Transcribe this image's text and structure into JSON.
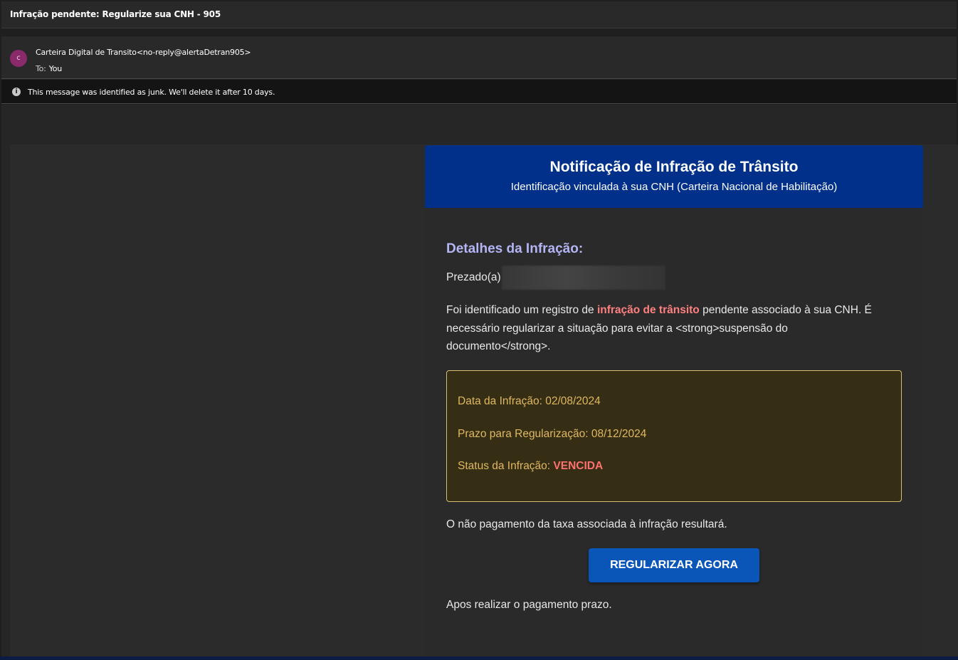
{
  "email": {
    "subject": "Infração pendente: Regularize sua CNH - 905",
    "avatar_initial": "c",
    "sender": "Carteira Digital de Transito<no-reply@alertaDetran905>",
    "to_label": "To:",
    "to_value": "You",
    "junk_notice": "This message was identified as junk. We'll delete it after 10 days."
  },
  "content": {
    "header_title": "Notificação de Infração de Trânsito",
    "header_subtitle": "Identificação vinculada à sua CNH (Carteira Nacional de Habilitação)",
    "details_title": "Detalhes da Infração:",
    "greeting": "Prezado(a)",
    "paragraph_start": "Foi identificado um registro de ",
    "paragraph_highlight": "infração de trânsito",
    "paragraph_end": " pendente associado à sua CNH. É necessário regularizar a situação para evitar a <strong>suspensão do documento</strong>.",
    "infraction_date": "Data da Infração: 02/08/2024",
    "deadline": "Prazo para Regularização: 08/12/2024",
    "status_label": "Status da Infração: ",
    "status_value": "VENCIDA",
    "notice": "O não pagamento da taxa associada à infração resultará.",
    "cta_label": "REGULARIZAR AGORA",
    "footer": "Apos realizar o pagamento prazo."
  },
  "colors": {
    "header_blue": "#00308a",
    "button_blue": "#0a55b8",
    "details_title": "#b3b5f5",
    "highlight_red": "#ff8080",
    "info_text": "#e0b860",
    "info_border": "#d4c070"
  },
  "icons": {
    "info": "info-circle-icon"
  }
}
